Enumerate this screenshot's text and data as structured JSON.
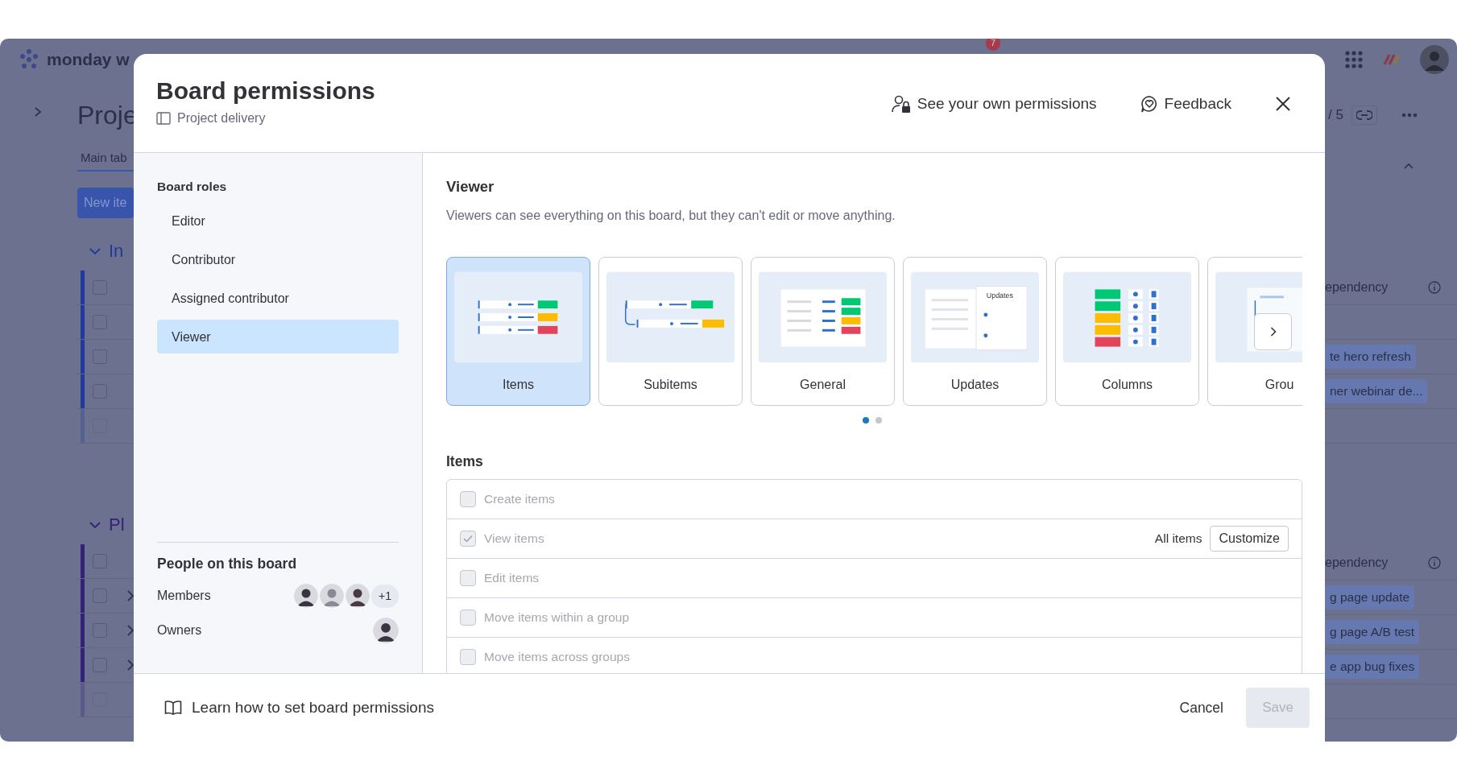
{
  "background_app": {
    "logo_text": "monday w",
    "notification_count": "7",
    "board_title": "Proje",
    "view_tab": "Main tab",
    "new_item_button": "New ite",
    "page_counter": "/ 5",
    "groups": [
      {
        "title": "In",
        "color": "#1f3a9c",
        "expanded": true,
        "all_checked": false,
        "column_header": "ependency",
        "rows": [
          {
            "kind": "item",
            "checked": false
          },
          {
            "kind": "item",
            "checked": false,
            "dependency": "te hero refresh"
          },
          {
            "kind": "item",
            "checked": false,
            "dependency": "ner webinar de..."
          },
          {
            "kind": "add",
            "checked": false
          }
        ]
      },
      {
        "title": "Pl",
        "color": "#33227a",
        "expanded": true,
        "all_checked": false,
        "column_header": "ependency",
        "rows": [
          {
            "kind": "item",
            "checked": false,
            "has_subitems": true,
            "dependency": "g page update"
          },
          {
            "kind": "item",
            "checked": false,
            "has_subitems": true,
            "dependency": "g page A/B test"
          },
          {
            "kind": "item",
            "checked": false,
            "has_subitems": true,
            "dependency": "e app bug fixes"
          },
          {
            "kind": "add",
            "checked": false
          }
        ]
      }
    ]
  },
  "dialog": {
    "title": "Board permissions",
    "board_name": "Project delivery",
    "own_permissions_link": "See your own permissions",
    "feedback_button": "Feedback",
    "sidebar": {
      "heading": "Board roles",
      "roles": [
        {
          "label": "Editor",
          "selected": false
        },
        {
          "label": "Contributor",
          "selected": false
        },
        {
          "label": "Assigned contributor",
          "selected": false
        },
        {
          "label": "Viewer",
          "selected": true
        }
      ],
      "people_heading": "People on this board",
      "people": [
        {
          "label": "Members",
          "avatars": [
            {
              "kind": "photo"
            },
            {
              "kind": "photo"
            },
            {
              "kind": "photo"
            }
          ],
          "extra_count": "+1"
        },
        {
          "label": "Owners",
          "avatars": [
            {
              "kind": "photo"
            }
          ]
        }
      ]
    },
    "role_title": "Viewer",
    "role_description": "Viewers can see everything on this board, but they can't edit or move anything.",
    "categories": [
      {
        "label": "Items",
        "kind": "items",
        "selected": true
      },
      {
        "label": "Subitems",
        "kind": "subitems",
        "selected": false
      },
      {
        "label": "General",
        "kind": "general",
        "selected": false
      },
      {
        "label": "Updates",
        "kind": "updates",
        "selected": false,
        "preview_text": "Updates"
      },
      {
        "label": "Columns",
        "kind": "columns",
        "selected": false
      },
      {
        "label": "Grou",
        "kind": "groups",
        "selected": false
      }
    ],
    "carousel_pages": [
      {
        "selected": true
      },
      {
        "selected": false
      }
    ],
    "section_title": "Items",
    "permissions": [
      {
        "label": "Create items",
        "checked": false,
        "disabled": true
      },
      {
        "label": "View items",
        "checked": true,
        "disabled": true,
        "scope": "All items",
        "action_button": "Customize"
      },
      {
        "label": "Edit items",
        "checked": false,
        "disabled": true
      },
      {
        "label": "Move items within a group",
        "checked": false,
        "disabled": true
      },
      {
        "label": "Move items across groups",
        "checked": false,
        "disabled": true
      }
    ],
    "learn_link": "Learn how to set board permissions",
    "cancel_button": "Cancel",
    "save_button": {
      "label": "Save",
      "disabled": true
    }
  }
}
